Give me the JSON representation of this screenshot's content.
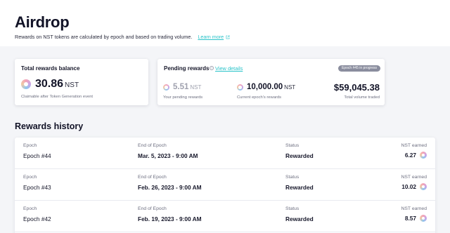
{
  "page": {
    "title": "Airdrop",
    "subtitle": "Rewards on NST tokens are calculated by epoch and based on trading volume.",
    "learn_more": "Learn more"
  },
  "total_rewards": {
    "title": "Total rewards balance",
    "value": "30.86",
    "unit": "NST",
    "caption": "Claimable after Token Generation event"
  },
  "pending": {
    "title": "Pending rewards",
    "info_icon": "i",
    "view_details": "View details",
    "badge": "Epoch #45 in progress",
    "your_value": "5.51",
    "your_unit": "NST",
    "your_caption": "Your pending rewards",
    "epoch_value": "10,000.00",
    "epoch_unit": "NST",
    "epoch_caption": "Current epoch's rewards",
    "volume_value": "$59,045.38",
    "volume_caption": "Total volume traded"
  },
  "history": {
    "title": "Rewards history",
    "columns": {
      "epoch": "Epoch",
      "end": "End of Epoch",
      "status": "Status",
      "earned": "NST earned"
    },
    "rows": [
      {
        "epoch": "Epoch #44",
        "end": "Mar. 5, 2023 - 9:00 AM",
        "status": "Rewarded",
        "earned": "6.27"
      },
      {
        "epoch": "Epoch #43",
        "end": "Feb. 26, 2023 - 9:00 AM",
        "status": "Rewarded",
        "earned": "10.02"
      },
      {
        "epoch": "Epoch #42",
        "end": "Feb. 19, 2023 - 9:00 AM",
        "status": "Rewarded",
        "earned": "8.57"
      }
    ]
  },
  "icons": [
    "external-link-icon",
    "nst-token-icon",
    "info-icon"
  ],
  "colors": {
    "accent": "#2ac3c9",
    "badge": "#8a8d9e",
    "background": "#f4f5f8"
  }
}
